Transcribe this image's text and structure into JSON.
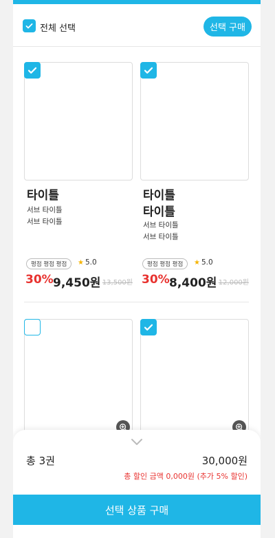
{
  "header": {
    "select_all_label": "전체 선택",
    "select_all_checked": true,
    "buy_selected_label": "선택 구매"
  },
  "products": [
    {
      "checked": true,
      "title_lines": [
        "타이틀"
      ],
      "subtitles": [
        "서브 타이틀",
        "서브 타이틀"
      ],
      "tag": "평점 평점 평점",
      "rating": "5.0",
      "discount": "30%",
      "price": "9,450원",
      "original_price": "13,500원"
    },
    {
      "checked": true,
      "title_lines": [
        "타이틀",
        "타이틀"
      ],
      "subtitles": [
        "서브 타이틀",
        "서브 타이틀"
      ],
      "tag": "평점 평점 평점",
      "rating": "5.0",
      "discount": "30%",
      "price": "8,400원",
      "original_price": "12,000원"
    },
    {
      "checked": false
    },
    {
      "checked": true
    }
  ],
  "summary": {
    "total_label": "총 3권",
    "total_price": "30,000원",
    "discount_note": "총 할인 금액 0,000원 (추가 5% 할인)"
  },
  "footer": {
    "buy_button_label": "선택 상품 구매"
  },
  "colors": {
    "accent": "#1fb6e6",
    "discount": "#e8322f"
  },
  "icons": [
    "check-icon",
    "star-icon",
    "zoom-in-icon",
    "chevron-down-icon"
  ]
}
